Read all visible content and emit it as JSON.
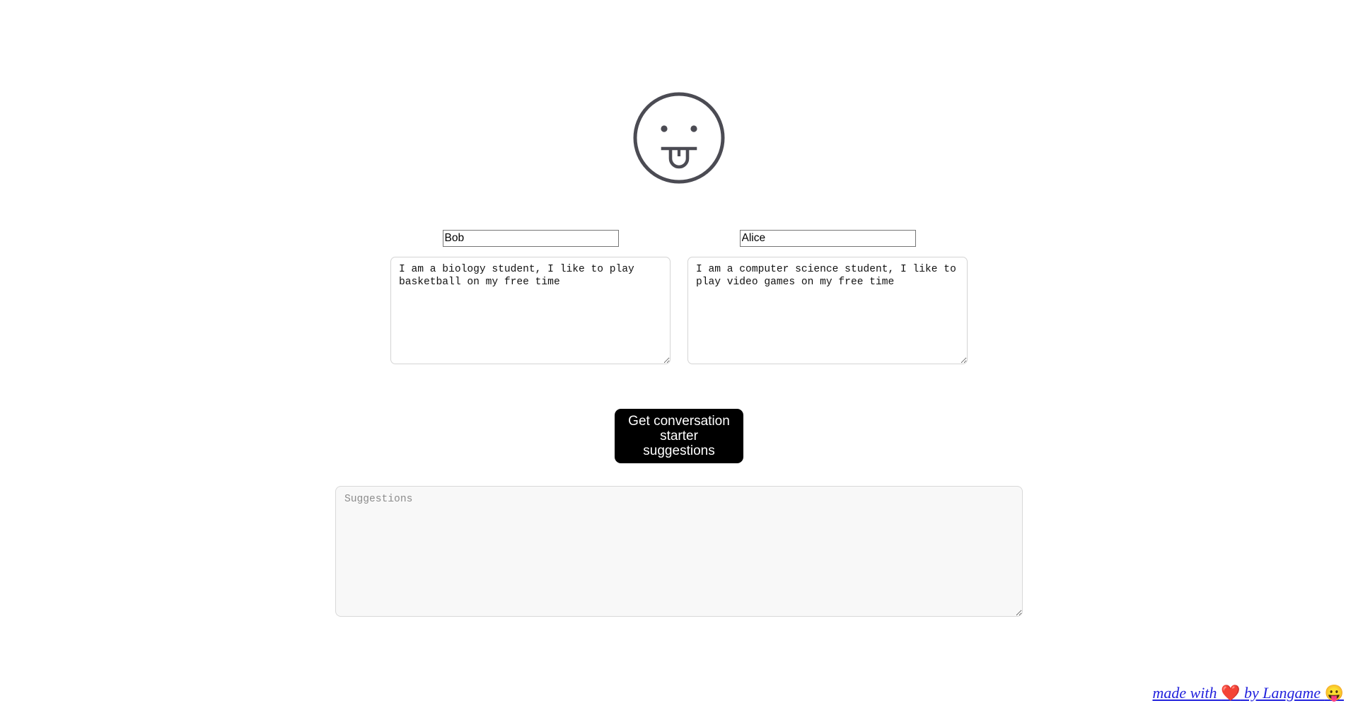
{
  "logo": {
    "icon": "face-tongue-out-icon",
    "stroke_color": "#4b4b53"
  },
  "personas": [
    {
      "name_value": "Bob",
      "name_placeholder": "",
      "bio_value": "I am a biology student, I like to play basketball on my free time",
      "bio_placeholder": ""
    },
    {
      "name_value": "Alice",
      "name_placeholder": "",
      "bio_value": "I am a computer science student, I like to play video games on my free time",
      "bio_placeholder": ""
    }
  ],
  "action": {
    "button_label": "Get conversation\nstarter suggestions",
    "button_bg": "#000000",
    "button_text_color": "#ffffff"
  },
  "output": {
    "placeholder": "Suggestions",
    "value": "",
    "background": "#f8f8f8"
  },
  "footer": {
    "text_before": "made with ",
    "heart_emoji": "❤️",
    "text_middle": " by Langame ",
    "face_emoji": "😛",
    "link_color": "#2222dd"
  }
}
